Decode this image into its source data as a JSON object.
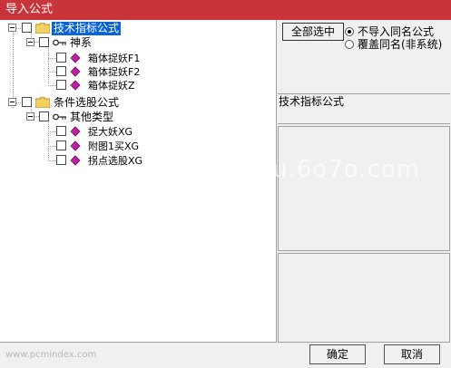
{
  "window": {
    "title": "导入公式"
  },
  "tree": {
    "root1": {
      "label": "技术指标公式"
    },
    "group1": {
      "label": "神系"
    },
    "leaves1": [
      "箱体捉妖F1",
      "箱体捉妖F2",
      "箱体捉妖Z"
    ],
    "root2": {
      "label": "条件选股公式"
    },
    "group2": {
      "label": "其他类型"
    },
    "leaves2": [
      "捉大妖XG",
      "附图1买XG",
      "拐点选股XG"
    ]
  },
  "options": {
    "select_all": "全部选中",
    "radio1": "不导入同名公式",
    "radio2": "覆盖同名(非系统)"
  },
  "info": {
    "label": "技术指标公式"
  },
  "buttons": {
    "ok": "确定",
    "cancel": "取消"
  },
  "watermarks": {
    "w1": "u.6o7o.com",
    "w2": "www.pcmindex.com"
  },
  "colors": {
    "titlebar": "#c8343a",
    "selection": "#0a64d8",
    "gem": "#c21ca8",
    "folder": "#f3d160"
  }
}
